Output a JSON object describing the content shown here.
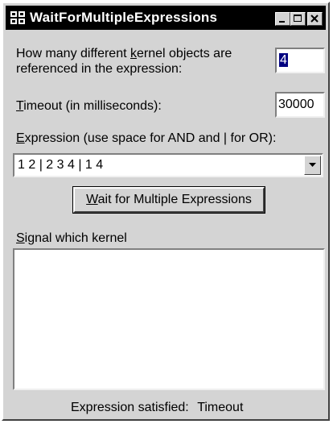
{
  "window": {
    "title": "WaitForMultipleExpressions",
    "title_bar_color": "#000000",
    "face_color": "#d4d4d4"
  },
  "caption_buttons": {
    "minimize_icon": "minimize-icon",
    "maximize_icon": "maximize-icon",
    "close_icon": "close-icon"
  },
  "form": {
    "kernel_objects_label_line1_pre": "How many different ",
    "kernel_objects_label_line1_accel": "k",
    "kernel_objects_label_line1_post": "ernel objects are",
    "kernel_objects_label_line2": "referenced in the expression:",
    "kernel_objects_value": "4",
    "timeout_label_accel": "T",
    "timeout_label_rest": "imeout (in milliseconds):",
    "timeout_value": "30000",
    "expression_label_accel": "E",
    "expression_label_rest": "xpression (use space for AND and | for OR):",
    "expression_value": "1 2 | 2 3 4 | 1 4",
    "wait_button_accel": "W",
    "wait_button_rest": "ait for Multiple Expressions",
    "signal_label_accel": "S",
    "signal_label_rest": "ignal which kernel",
    "signal_list_items": [],
    "status_label": "Expression satisfied:",
    "status_value": "Timeout"
  }
}
